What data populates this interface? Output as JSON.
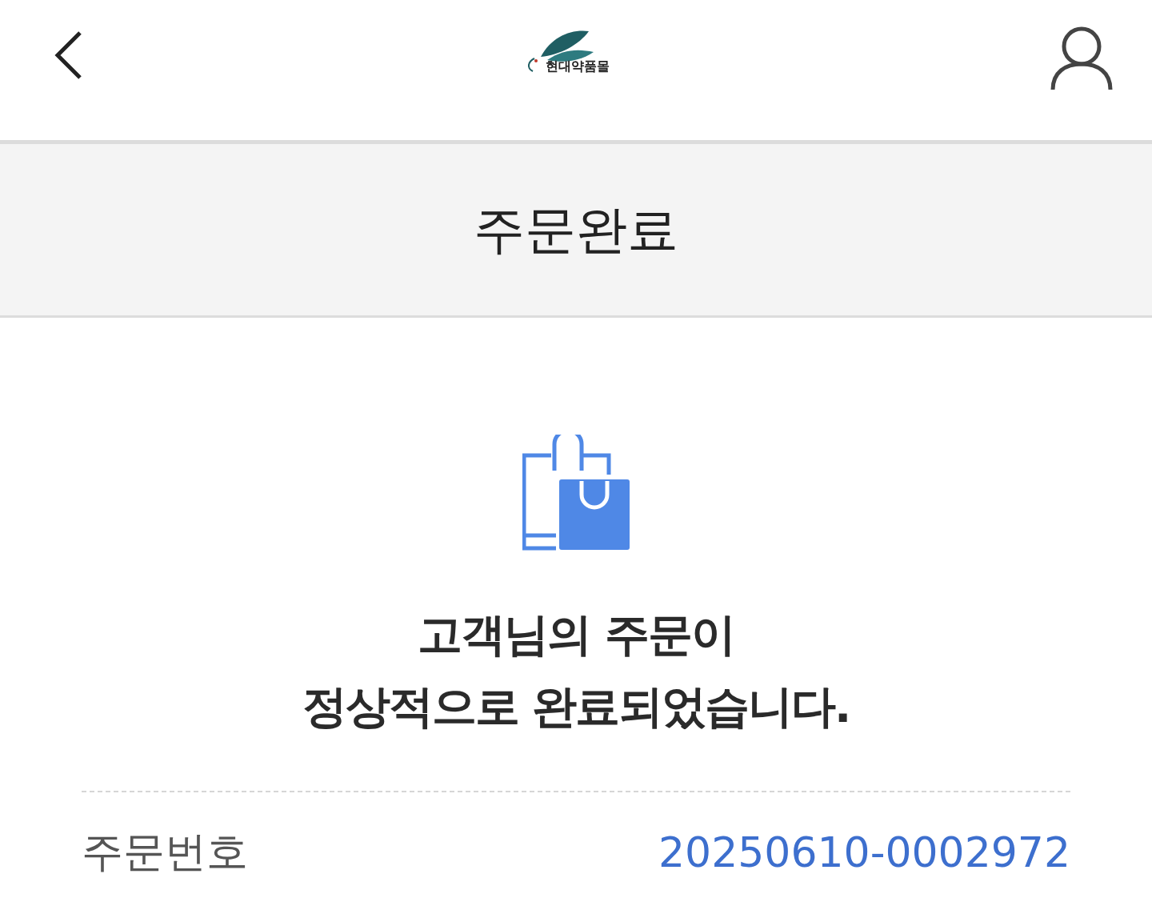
{
  "header": {
    "logo_text": "현대약품몰"
  },
  "page_title": "주문완료",
  "message_lines": [
    "고객님의 주문이",
    "정상적으로 완료되었습니다."
  ],
  "order": {
    "label": "주문번호",
    "value": "20250610-0002972"
  }
}
